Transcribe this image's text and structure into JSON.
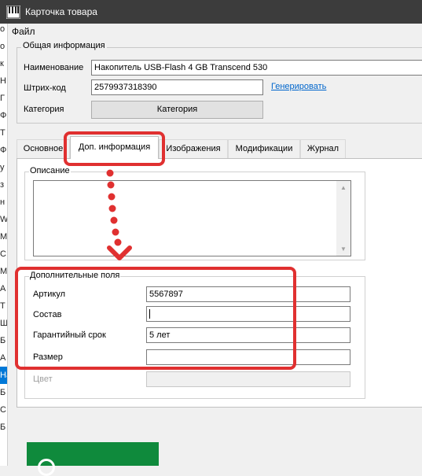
{
  "window": {
    "title": "Карточка товара",
    "app_icon": "piano-keys-icon"
  },
  "menu": {
    "file": "Файл"
  },
  "background_list": {
    "rows": [
      "о",
      "о",
      "к",
      "Н",
      "Г",
      "Ф",
      "Т",
      "Ф",
      "у",
      "з",
      "н",
      "W",
      "М",
      "С",
      "М",
      "А",
      "Т",
      "Ш",
      "Б",
      "А",
      "На",
      "Б",
      "С",
      "Б"
    ]
  },
  "general": {
    "title": "Общая информация",
    "name_label": "Наименование",
    "name_value": "Накопитель USB-Flash 4 GB Transcend 530",
    "barcode_label": "Штрих-код",
    "barcode_value": "2579937318390",
    "generate_link": "Генерировать",
    "category_label": "Категория",
    "category_button": "Категория"
  },
  "tabs": [
    {
      "label": "Основное"
    },
    {
      "label": "Доп. информация"
    },
    {
      "label": "Изображения"
    },
    {
      "label": "Модификации"
    },
    {
      "label": "Журнал"
    }
  ],
  "active_tab": "Доп. информация",
  "description": {
    "title": "Описание",
    "value": ""
  },
  "extra_fields": {
    "title": "Дополнительные поля",
    "fields": [
      {
        "label": "Артикул",
        "value": "5567897"
      },
      {
        "label": "Состав",
        "value": ""
      },
      {
        "label": "Гарантийный срок",
        "value": "5 лет"
      },
      {
        "label": "Размер",
        "value": ""
      },
      {
        "label": "Цвет",
        "value": ""
      }
    ]
  },
  "colors": {
    "titlebar": "#3c3c3c",
    "annotation": "#e03030",
    "link": "#0066cc",
    "green_block": "#0f8a3c",
    "selection": "#0078d7"
  }
}
